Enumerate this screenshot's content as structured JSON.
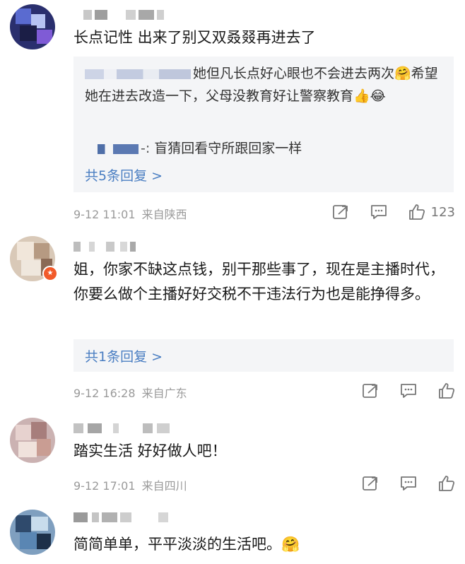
{
  "comments": [
    {
      "text": "长点记性 出来了别又双叒叕再进去了",
      "replies": [
        {
          "text": "她但凡长点好心眼也不会进去两次🤗希望她在进去改造一下，父母没教育好让警察教育👍😂"
        },
        {
          "text": "盲猜回看守所跟回家一样"
        }
      ],
      "reply_link": "共5条回复 >",
      "time": "9-12 11:01",
      "location": "来自陕西",
      "like_count": "123"
    },
    {
      "text": "姐，你家不缺这点钱，别干那些事了，现在是主播时代，你要么做个主播好好交税不干违法行为也是能挣得多。",
      "reply_link": "共1条回复 >",
      "time": "9-12 16:28",
      "location": "来自广东"
    },
    {
      "text": "踏实生活 好好做人吧！",
      "time": "9-12 17:01",
      "location": "来自四川"
    },
    {
      "text": "简简单单，平平淡淡的生活吧。🤗"
    }
  ],
  "colors": {
    "link": "#4a7ec2",
    "reply_bg": "#f4f5f7",
    "meta": "#9a9a9a",
    "vip_badge": "#f25a2a"
  },
  "icons": [
    "share-icon",
    "comment-icon",
    "like-icon"
  ]
}
